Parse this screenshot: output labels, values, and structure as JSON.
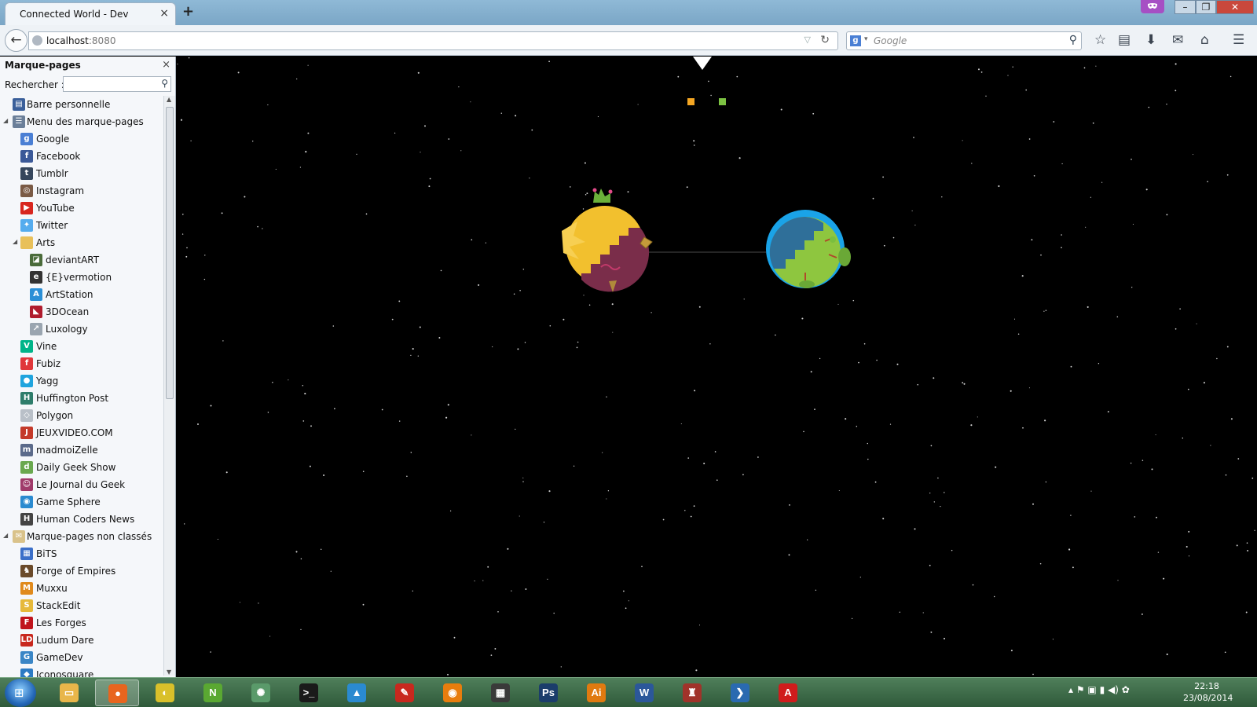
{
  "browser": {
    "tab_title": "Connected World - Dev",
    "tab_close": "×",
    "new_tab": "+",
    "url_host": "localhost",
    "url_port": ":8080",
    "search_placeholder": "Google",
    "search_engine_glyph": "g"
  },
  "window": {
    "minimize": "–",
    "maximize": "❐",
    "close": "✕"
  },
  "sidebar": {
    "title": "Marque-pages",
    "close": "×",
    "search_label": "Rechercher :",
    "items": [
      {
        "label": "Barre personnelle",
        "level": 0,
        "twisty": "",
        "icon_color": "#3a5f9a",
        "glyph": "▤"
      },
      {
        "label": "Menu des marque-pages",
        "level": 0,
        "twisty": "◢",
        "icon_color": "#6b7f99",
        "glyph": "☰"
      },
      {
        "label": "Google",
        "level": 1,
        "twisty": "",
        "icon_color": "#4a7fd4",
        "glyph": "g"
      },
      {
        "label": "Facebook",
        "level": 1,
        "twisty": "",
        "icon_color": "#3b5998",
        "glyph": "f"
      },
      {
        "label": "Tumblr",
        "level": 1,
        "twisty": "",
        "icon_color": "#35465c",
        "glyph": "t"
      },
      {
        "label": "Instagram",
        "level": 1,
        "twisty": "",
        "icon_color": "#7a5a45",
        "glyph": "◎"
      },
      {
        "label": "YouTube",
        "level": 1,
        "twisty": "",
        "icon_color": "#d8261f",
        "glyph": "▶"
      },
      {
        "label": "Twitter",
        "level": 1,
        "twisty": "",
        "icon_color": "#55acee",
        "glyph": "✦"
      },
      {
        "label": "Arts",
        "level": 1,
        "twisty": "◢",
        "icon_color": "#e8c05a",
        "glyph": ""
      },
      {
        "label": "deviantART",
        "level": 2,
        "twisty": "",
        "icon_color": "#4a6b3a",
        "glyph": "◪"
      },
      {
        "label": "{E}vermotion",
        "level": 2,
        "twisty": "",
        "icon_color": "#333333",
        "glyph": "e"
      },
      {
        "label": "ArtStation",
        "level": 2,
        "twisty": "",
        "icon_color": "#2b8fd6",
        "glyph": "A"
      },
      {
        "label": "3DOcean",
        "level": 2,
        "twisty": "",
        "icon_color": "#b01c2e",
        "glyph": "◣"
      },
      {
        "label": "Luxology",
        "level": 2,
        "twisty": "",
        "icon_color": "#9aa5b0",
        "glyph": "↗"
      },
      {
        "label": "Vine",
        "level": 1,
        "twisty": "",
        "icon_color": "#00b489",
        "glyph": "V"
      },
      {
        "label": "Fubiz",
        "level": 1,
        "twisty": "",
        "icon_color": "#e0373b",
        "glyph": "f"
      },
      {
        "label": "Yagg",
        "level": 1,
        "twisty": "",
        "icon_color": "#1fa4de",
        "glyph": "●"
      },
      {
        "label": "Huffington Post",
        "level": 1,
        "twisty": "",
        "icon_color": "#2e7d6b",
        "glyph": "H"
      },
      {
        "label": "Polygon",
        "level": 1,
        "twisty": "",
        "icon_color": "#b9c0c8",
        "glyph": "◇"
      },
      {
        "label": "JEUXVIDEO.COM",
        "level": 1,
        "twisty": "",
        "icon_color": "#c43a2a",
        "glyph": "J"
      },
      {
        "label": "madmoiZelle",
        "level": 1,
        "twisty": "",
        "icon_color": "#5b6a8a",
        "glyph": "m"
      },
      {
        "label": "Daily Geek Show",
        "level": 1,
        "twisty": "",
        "icon_color": "#6aa84f",
        "glyph": "d"
      },
      {
        "label": "Le Journal du Geek",
        "level": 1,
        "twisty": "",
        "icon_color": "#a03a6a",
        "glyph": "☺"
      },
      {
        "label": "Game Sphere",
        "level": 1,
        "twisty": "",
        "icon_color": "#2a8ad0",
        "glyph": "◉"
      },
      {
        "label": "Human Coders News",
        "level": 1,
        "twisty": "",
        "icon_color": "#444444",
        "glyph": "H"
      },
      {
        "label": "Marque-pages non classés",
        "level": 0,
        "twisty": "◢",
        "icon_color": "#d9c28a",
        "glyph": "✉"
      },
      {
        "label": "BiTS",
        "level": 1,
        "twisty": "",
        "icon_color": "#3b6fc9",
        "glyph": "▦"
      },
      {
        "label": "Forge of Empires",
        "level": 1,
        "twisty": "",
        "icon_color": "#6a4a2a",
        "glyph": "♞"
      },
      {
        "label": "Muxxu",
        "level": 1,
        "twisty": "",
        "icon_color": "#e08a1c",
        "glyph": "M"
      },
      {
        "label": "StackEdit",
        "level": 1,
        "twisty": "",
        "icon_color": "#e6b93a",
        "glyph": "S"
      },
      {
        "label": "Les Forges",
        "level": 1,
        "twisty": "",
        "icon_color": "#c0141c",
        "glyph": "F"
      },
      {
        "label": "Ludum Dare",
        "level": 1,
        "twisty": "",
        "icon_color": "#c8281e",
        "glyph": "LD"
      },
      {
        "label": "GameDev",
        "level": 1,
        "twisty": "",
        "icon_color": "#3a86c6",
        "glyph": "G"
      },
      {
        "label": "Iconosquare",
        "level": 1,
        "twisty": "",
        "icon_color": "#2c7bc4",
        "glyph": "◆"
      }
    ]
  },
  "game": {
    "colors": {
      "planet1_body": "#f2c02e",
      "planet1_shadow": "#7a2d4a",
      "planet2_body": "#8ec63f",
      "planet2_shadow": "#2f6f99",
      "planet2_ring": "#1aa3e8",
      "marker_orange": "#f4a623",
      "marker_green": "#7cc242"
    }
  },
  "taskbar": {
    "start_glyph": "⊞",
    "apps": [
      {
        "name": "explorer",
        "glyph": "▭",
        "color": "#e8b64a",
        "active": false
      },
      {
        "name": "firefox",
        "glyph": "●",
        "color": "#e8651e",
        "active": true
      },
      {
        "name": "app-lemon",
        "glyph": "◐",
        "color": "#d9c02a",
        "active": false
      },
      {
        "name": "app-n",
        "glyph": "N",
        "color": "#5aa832",
        "active": false
      },
      {
        "name": "atom",
        "glyph": "✺",
        "color": "#5a9a6a",
        "active": false
      },
      {
        "name": "terminal",
        "glyph": ">_",
        "color": "#1a1a1a",
        "active": false
      },
      {
        "name": "app-a",
        "glyph": "▲",
        "color": "#2a8ad0",
        "active": false
      },
      {
        "name": "app-pen",
        "glyph": "✎",
        "color": "#c8281e",
        "active": false
      },
      {
        "name": "blender",
        "glyph": "◉",
        "color": "#e87d0d",
        "active": false
      },
      {
        "name": "film",
        "glyph": "▦",
        "color": "#3a3a3a",
        "active": false
      },
      {
        "name": "photoshop",
        "glyph": "Ps",
        "color": "#1b3d6b",
        "active": false
      },
      {
        "name": "illustrator",
        "glyph": "Ai",
        "color": "#e07a10",
        "active": false
      },
      {
        "name": "word",
        "glyph": "W",
        "color": "#2b579a",
        "active": false
      },
      {
        "name": "app-castle",
        "glyph": "♜",
        "color": "#a0332a",
        "active": false
      },
      {
        "name": "powershell",
        "glyph": "❯",
        "color": "#2a6ab0",
        "active": false
      },
      {
        "name": "acrobat",
        "glyph": "A",
        "color": "#d01c1c",
        "active": false
      }
    ],
    "tray": "▴  ⚑  ▣  ▮  ◀)  ✿",
    "time": "22:18",
    "date": "23/08/2014"
  }
}
